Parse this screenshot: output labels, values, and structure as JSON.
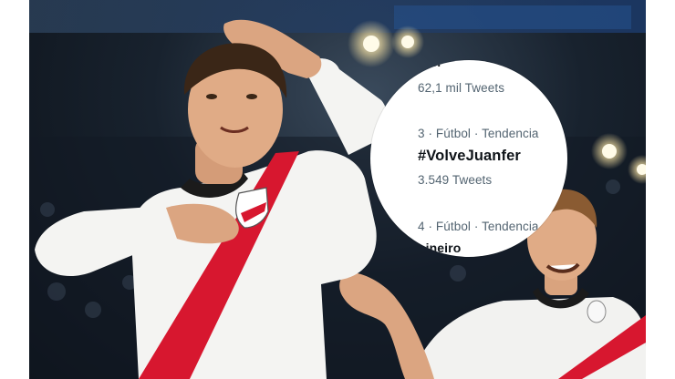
{
  "trends": {
    "partial_top_name": "nan",
    "top_count": "62,1 mil Tweets",
    "item3_meta": "3 · Fútbol · Tendencia",
    "item3_tag": "#VolveJuanfer",
    "item3_count": "3.549 Tweets",
    "item4_meta": "4 · Fútbol · Tendencia",
    "item4_partial_name": "oineiro"
  },
  "colors": {
    "kit_red": "#d7172f",
    "kit_white": "#f4f4f2",
    "twitter_secondary_text": "#536471",
    "twitter_primary_text": "#0f1419"
  }
}
